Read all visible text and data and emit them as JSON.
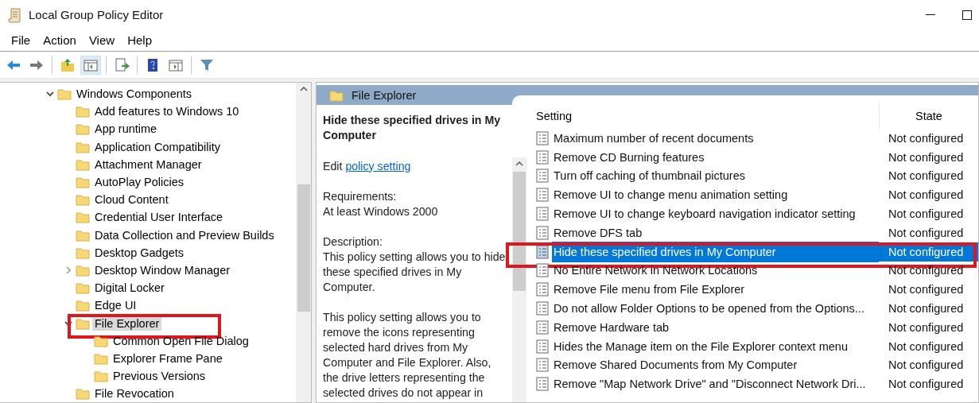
{
  "window": {
    "title": "Local Group Policy Editor"
  },
  "menu": [
    "File",
    "Action",
    "View",
    "Help"
  ],
  "toolbar": [
    {
      "kind": "back",
      "pressed": false
    },
    {
      "kind": "forward",
      "pressed": false
    },
    {
      "kind": "sep"
    },
    {
      "kind": "up",
      "pressed": false
    },
    {
      "kind": "tree",
      "pressed": true
    },
    {
      "kind": "sep"
    },
    {
      "kind": "export",
      "pressed": false
    },
    {
      "kind": "sep"
    },
    {
      "kind": "help",
      "pressed": false
    },
    {
      "kind": "pane",
      "pressed": false
    },
    {
      "kind": "sep"
    },
    {
      "kind": "filter",
      "pressed": false
    }
  ],
  "tree": [
    {
      "label": "Windows Components",
      "expanded": true,
      "selected": false,
      "annotated": false,
      "children": [
        {
          "label": "Add features to Windows 10",
          "selected": false,
          "annotated": false
        },
        {
          "label": "App runtime",
          "selected": false,
          "annotated": false
        },
        {
          "label": "Application Compatibility",
          "selected": false,
          "annotated": false
        },
        {
          "label": "Attachment Manager",
          "selected": false,
          "annotated": false
        },
        {
          "label": "AutoPlay Policies",
          "selected": false,
          "annotated": false
        },
        {
          "label": "Cloud Content",
          "selected": false,
          "annotated": false
        },
        {
          "label": "Credential User Interface",
          "selected": false,
          "annotated": false
        },
        {
          "label": "Data Collection and Preview Builds",
          "selected": false,
          "annotated": false
        },
        {
          "label": "Desktop Gadgets",
          "selected": false,
          "annotated": false
        },
        {
          "label": "Desktop Window Manager",
          "expanded": false,
          "selected": false,
          "annotated": false
        },
        {
          "label": "Digital Locker",
          "selected": false,
          "annotated": false
        },
        {
          "label": "Edge UI",
          "selected": false,
          "annotated": false
        },
        {
          "label": "File Explorer",
          "expanded": true,
          "selected": true,
          "annotated": true,
          "children": [
            {
              "label": "Common Open File Dialog",
              "selected": false,
              "annotated": false
            },
            {
              "label": "Explorer Frame Pane",
              "selected": false,
              "annotated": false
            },
            {
              "label": "Previous Versions",
              "selected": false,
              "annotated": false
            }
          ]
        },
        {
          "label": "File Revocation",
          "selected": false,
          "annotated": false
        }
      ]
    }
  ],
  "details": {
    "header": "File Explorer",
    "title": "Hide these specified drives in My Computer",
    "edit_prefix": "Edit",
    "edit_link": "policy setting",
    "requirements_label": "Requirements:",
    "requirements": "At least Windows 2000",
    "description_label": "Description:",
    "paragraphs": [
      "This policy setting allows you to hide these specified drives in My Computer.",
      "This policy setting allows you to remove the icons representing selected hard drives from My Computer and File Explorer. Also, the drive letters representing the selected drives do not appear in"
    ]
  },
  "table": {
    "columns": [
      "Setting",
      "State"
    ],
    "rows": [
      {
        "setting": "Maximum number of recent documents",
        "state": "Not configured",
        "selected": false,
        "annotated": false
      },
      {
        "setting": "Remove CD Burning features",
        "state": "Not configured",
        "selected": false,
        "annotated": false
      },
      {
        "setting": "Turn off caching of thumbnail pictures",
        "state": "Not configured",
        "selected": false,
        "annotated": false
      },
      {
        "setting": "Remove UI to change menu animation setting",
        "state": "Not configured",
        "selected": false,
        "annotated": false
      },
      {
        "setting": "Remove UI to change keyboard navigation indicator setting",
        "state": "Not configured",
        "selected": false,
        "annotated": false
      },
      {
        "setting": "Remove DFS tab",
        "state": "Not configured",
        "selected": false,
        "annotated": false
      },
      {
        "setting": "Hide these specified drives in My Computer",
        "state": "Not configured",
        "selected": true,
        "annotated": true
      },
      {
        "setting": "No Entire Network in Network Locations",
        "state": "Not configured",
        "selected": false,
        "annotated": false
      },
      {
        "setting": "Remove File menu from File Explorer",
        "state": "Not configured",
        "selected": false,
        "annotated": false
      },
      {
        "setting": "Do not allow Folder Options to be opened from the Options...",
        "state": "Not configured",
        "selected": false,
        "annotated": false
      },
      {
        "setting": "Remove Hardware tab",
        "state": "Not configured",
        "selected": false,
        "annotated": false
      },
      {
        "setting": "Hides the Manage item on the File Explorer context menu",
        "state": "Not configured",
        "selected": false,
        "annotated": false
      },
      {
        "setting": "Remove Shared Documents from My Computer",
        "state": "Not configured",
        "selected": false,
        "annotated": false
      },
      {
        "setting": "Remove \"Map Network Drive\" and \"Disconnect Network Dri...",
        "state": "Not configured",
        "selected": false,
        "annotated": false
      }
    ]
  }
}
